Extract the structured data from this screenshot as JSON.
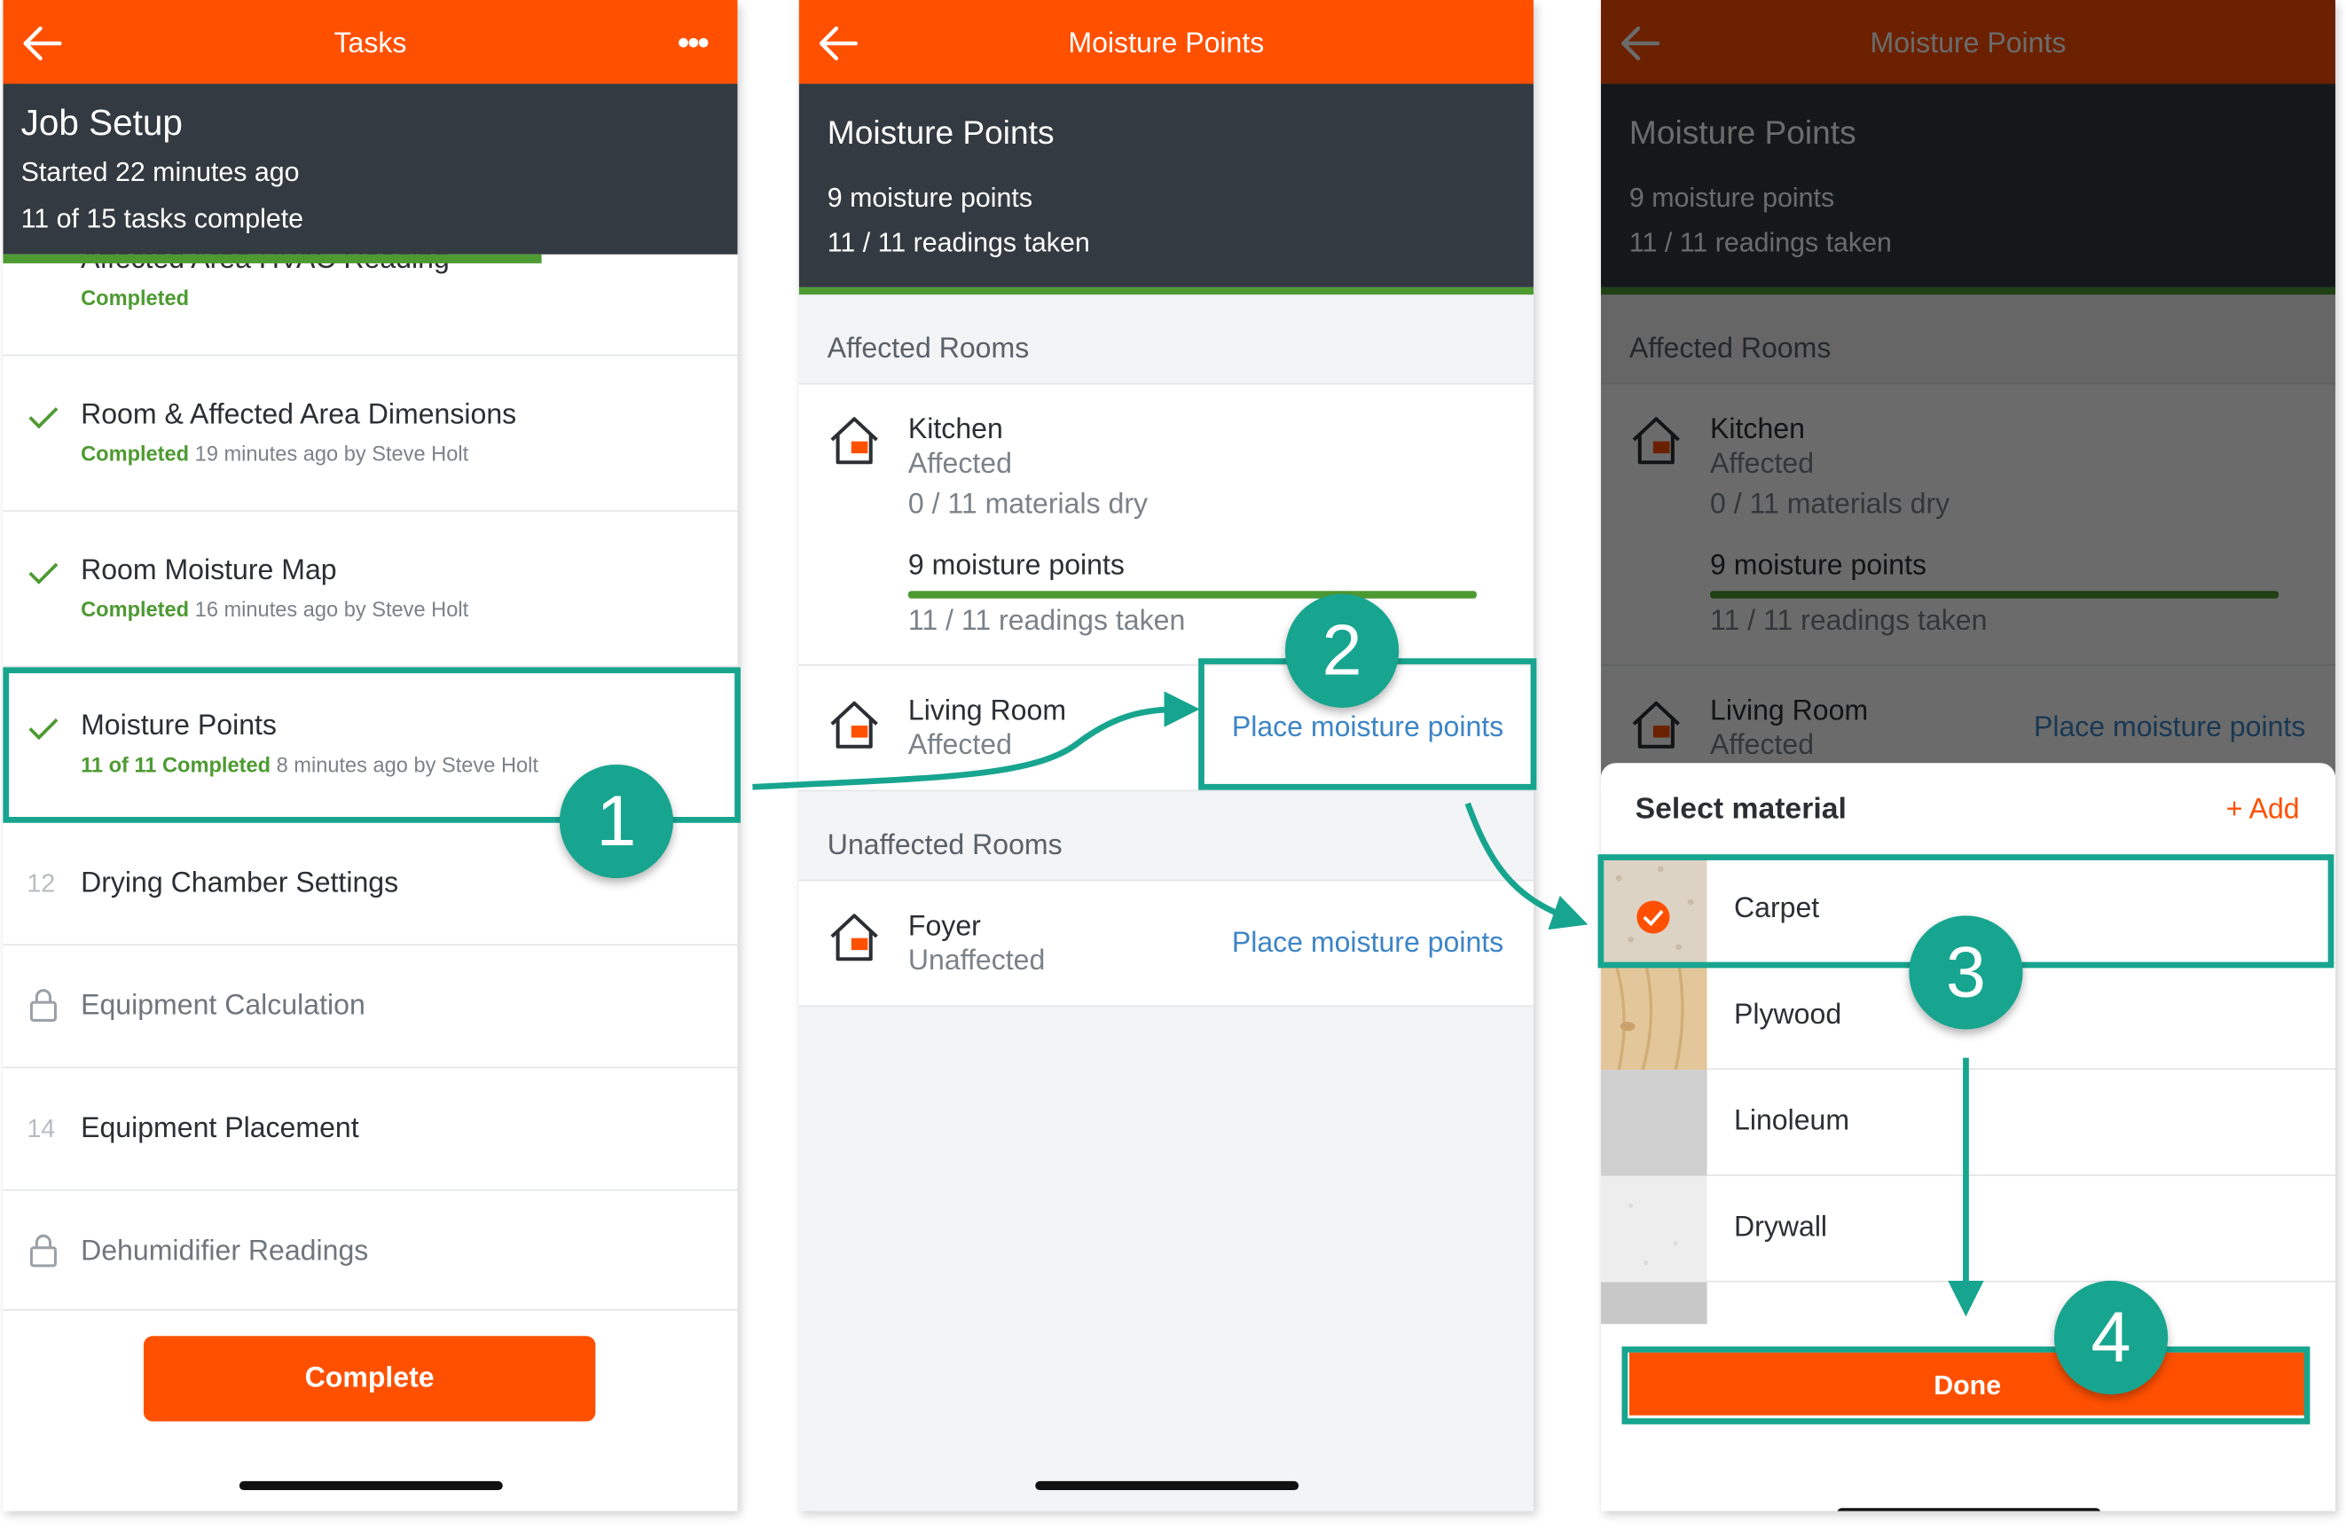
{
  "panel1": {
    "header_title": "Tasks",
    "summary_title": "Job Setup",
    "started": "Started 22 minutes ago",
    "complete_count": "11 of 15 tasks complete",
    "progress_fraction": 0.733,
    "partial_task_name": "Affected Area HVAC Reading",
    "partial_task_status": "Completed",
    "tasks": [
      {
        "name": "Room & Affected Area Dimensions",
        "status": "Completed",
        "meta": "19 minutes ago by Steve Holt"
      },
      {
        "name": "Room Moisture Map",
        "status": "Completed",
        "meta": "16 minutes ago by Steve Holt"
      },
      {
        "name": "Moisture Points",
        "status": "11 of 11 Completed",
        "meta": "8 minutes ago by Steve Holt"
      },
      {
        "name": "Drying Chamber Settings",
        "number": "12"
      },
      {
        "name": "Equipment Calculation",
        "icon": "lock-icon"
      },
      {
        "name": "Equipment Placement",
        "number": "14"
      },
      {
        "name": "Dehumidifier Readings",
        "icon": "lock-icon"
      }
    ],
    "complete_button": "Complete"
  },
  "panel2": {
    "header_title": "Moisture Points",
    "summary_title": "Moisture Points",
    "points": "9 moisture points",
    "readings": "11 / 11 readings taken",
    "affected_heading": "Affected Rooms",
    "kitchen": {
      "name": "Kitchen",
      "status": "Affected",
      "dry": "0 / 11 materials dry",
      "points": "9 moisture points",
      "readings": "11 / 11 readings taken",
      "readings_fraction": 1.0
    },
    "living": {
      "name": "Living Room",
      "status": "Affected",
      "link": "Place moisture points"
    },
    "unaffected_heading": "Unaffected Rooms",
    "foyer": {
      "name": "Foyer",
      "status": "Unaffected",
      "link": "Place moisture points"
    }
  },
  "panel3": {
    "sheet_title": "Select material",
    "add_link": "+ Add",
    "materials": [
      "Carpet",
      "Plywood",
      "Linoleum",
      "Drywall"
    ],
    "selected_material": "Carpet",
    "done_button": "Done"
  },
  "steps": [
    "1",
    "2",
    "3",
    "4"
  ],
  "colors": {
    "brand_orange": "#ff5000",
    "header_dark": "#333a41",
    "success_green": "#4e9a32",
    "link_blue": "#3d85c6",
    "annotation_teal": "#17a58f"
  }
}
